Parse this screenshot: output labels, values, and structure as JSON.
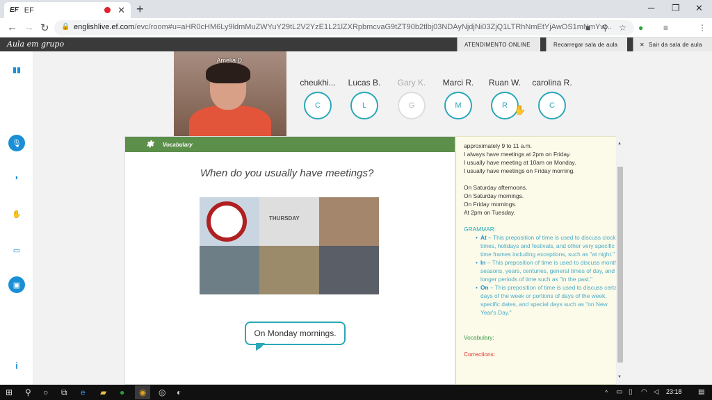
{
  "browser": {
    "tab_favicon": "EF",
    "tab_title": "EF",
    "tab_close": "✕",
    "new_tab": "+",
    "url_host": "englishlive.ef.com",
    "url_path": "/evc/room#u=aHR0cHM6Ly9ldmMuZWYuY29tL2V2YzE1L21lZXRpbmcvaG9tZT90b2tlbj03NDAyNjdjNi03ZjQ1LTRhNmEtYjAwOS1mNmYw...",
    "window_controls": [
      "─",
      "❐",
      "✕"
    ]
  },
  "app": {
    "title": "Aula em grupo",
    "buttons": [
      "ATENDIMENTO ONLINE",
      "Recarregar sala de aula",
      "Sair da sala de aula"
    ]
  },
  "sidebar": {
    "icons": [
      "stats-icon",
      "microphone-icon",
      "ear-icon",
      "hand-icon",
      "chat-icon",
      "screen-icon",
      "info-icon"
    ]
  },
  "teacher": {
    "name": "Amelia D."
  },
  "participants": [
    {
      "name": "cheukhi...",
      "initial": "C",
      "dim": false
    },
    {
      "name": "Lucas B.",
      "initial": "L",
      "dim": false
    },
    {
      "name": "Gary K.",
      "initial": "G",
      "dim": true
    },
    {
      "name": "Marci R.",
      "initial": "M",
      "dim": false
    },
    {
      "name": "Ruan W.",
      "initial": "R",
      "dim": false
    },
    {
      "name": "carolina R.",
      "initial": "C",
      "dim": false
    }
  ],
  "slide": {
    "header": "Vocabulary",
    "question": "When do you usually have meetings?",
    "calendar_word": "THURSDAY",
    "answer": "On Monday mornings."
  },
  "notes": {
    "lines_a": [
      "approximately 9 to 11 a.m.",
      "I always have meetings at 2pm on Friday.",
      "I usually have meeting at 10am on Monday.",
      "I usually have meetings on Friday morning."
    ],
    "lines_b": [
      "On Saturday afternoons.",
      "On Saturday mornings.",
      "On Friday mornings.",
      "At 2pm on Tuesday."
    ],
    "grammar_label": "GRAMMAR:",
    "grammar_items": [
      {
        "head": "At",
        "text": " – This preposition of time is used to discuss clock times, holidays and festivals, and other very specific time frames including exceptions, such as \"at night.\""
      },
      {
        "head": "In",
        "text": " – This preposition of time is used to discuss months, seasons, years, centuries, general times of day, and longer periods of time such as \"in the past.\""
      },
      {
        "head": "On",
        "text": " – This preposition of time is used to discuss certain days of the week or portions of days of the week, specific dates, and special days such as \"on New Year's Day.\""
      }
    ],
    "vocabulary_label": "Vocabulary:",
    "corrections_label": "Corrections:"
  },
  "taskbar": {
    "time": "23:18"
  }
}
